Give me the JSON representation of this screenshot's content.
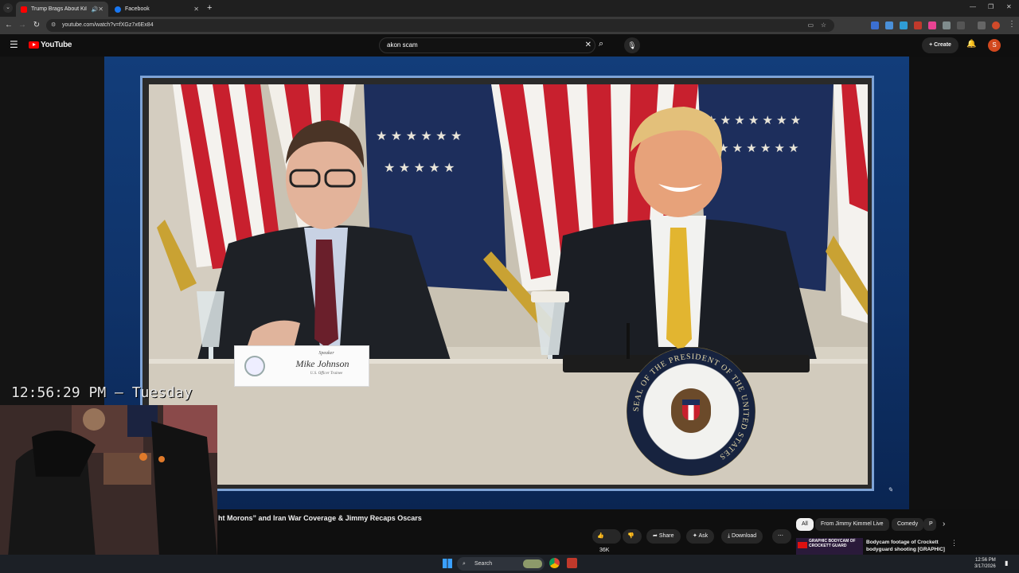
{
  "browser": {
    "tabs": [
      {
        "title": "Trump Brags About Killing",
        "active": true,
        "favicon_color": "#ff0000"
      },
      {
        "title": "Facebook",
        "active": false,
        "favicon_color": "#1877f2"
      }
    ],
    "url": "youtube.com/watch?v=fXGz7x6Ex84"
  },
  "youtube": {
    "logo_text": "YouTube",
    "search_value": "akon scam",
    "create_label": "Create",
    "avatar_letter": "S"
  },
  "overlay": {
    "clock_text": "12:56:29 PM — Tuesday"
  },
  "video": {
    "nameplate_top": "Speaker",
    "nameplate_name": "Mike Johnson",
    "nameplate_sub": "U.S. Officer Trainee",
    "seal_text": "SEAL OF THE PRESIDENT OF THE UNITED STATES",
    "title": "ht Morons” and Iran War Coverage & Jimmy Recaps Oscars",
    "likes": "36K",
    "actions": {
      "share": "Share",
      "ask": "Ask",
      "download": "Download"
    }
  },
  "related": {
    "chips": [
      "All",
      "From Jimmy Kimmel Live",
      "Comedy",
      "P"
    ],
    "first_video_title": "Bodycam footage of Crockett bodyguard shooting [GRAPHIC]",
    "thumb_caption": "GRAPHIC BODYCAM OF CROCKETT GUARD"
  },
  "taskbar": {
    "search_label": "Search",
    "time": "12:56 PM",
    "date": "3/17/2026"
  },
  "colors": {
    "accent_red": "#ff0000",
    "tie_gold": "#e2b530",
    "flag_blue": "#1d2e5c"
  }
}
